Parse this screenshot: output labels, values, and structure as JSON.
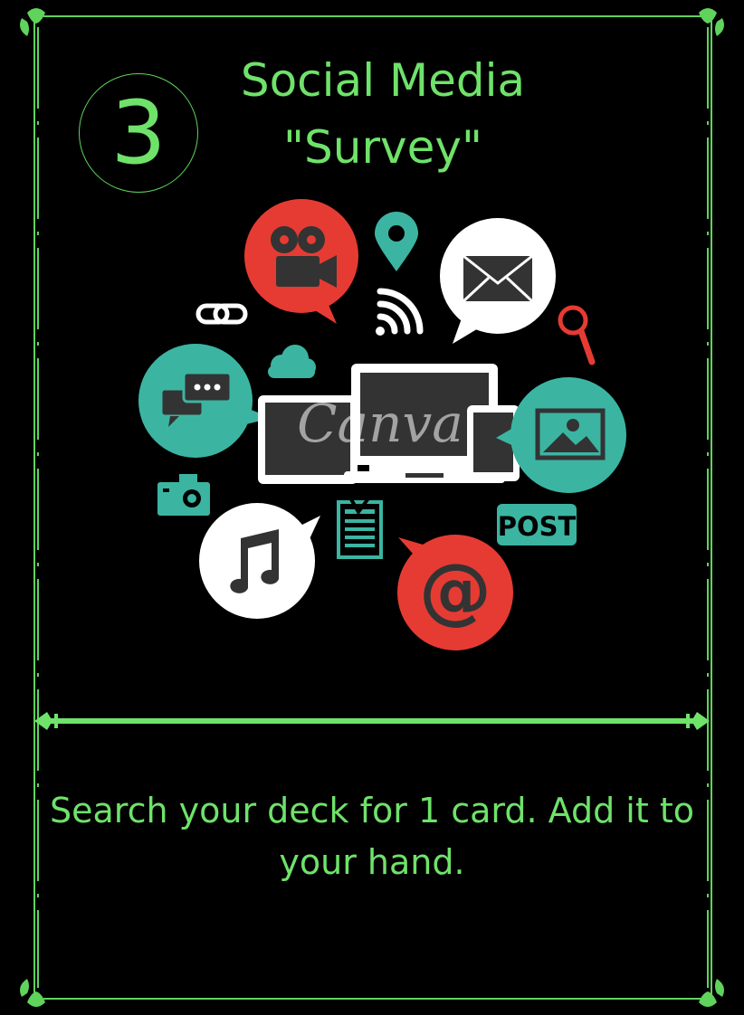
{
  "card": {
    "cost": "3",
    "title_line1": "Social Media",
    "title_line2": "\"Survey\"",
    "effect_text": "Search your deck for 1 card. Add it to your hand.",
    "art_watermark": "Canva",
    "art_post_label": "POST"
  },
  "colors": {
    "background": "#000000",
    "accent_green": "#6fe26a",
    "icon_red": "#e63b33",
    "icon_teal": "#3bb5a2",
    "icon_white": "#ffffff",
    "device_gray": "#333333"
  },
  "icons": [
    "video-camera-icon",
    "location-pin-icon",
    "envelope-icon",
    "link-icon",
    "wifi-icon",
    "magnifier-icon",
    "cloud-icon",
    "chat-icon",
    "devices-icon",
    "image-icon",
    "camera-icon",
    "document-icon",
    "post-tag-icon",
    "music-note-icon",
    "at-sign-icon"
  ]
}
